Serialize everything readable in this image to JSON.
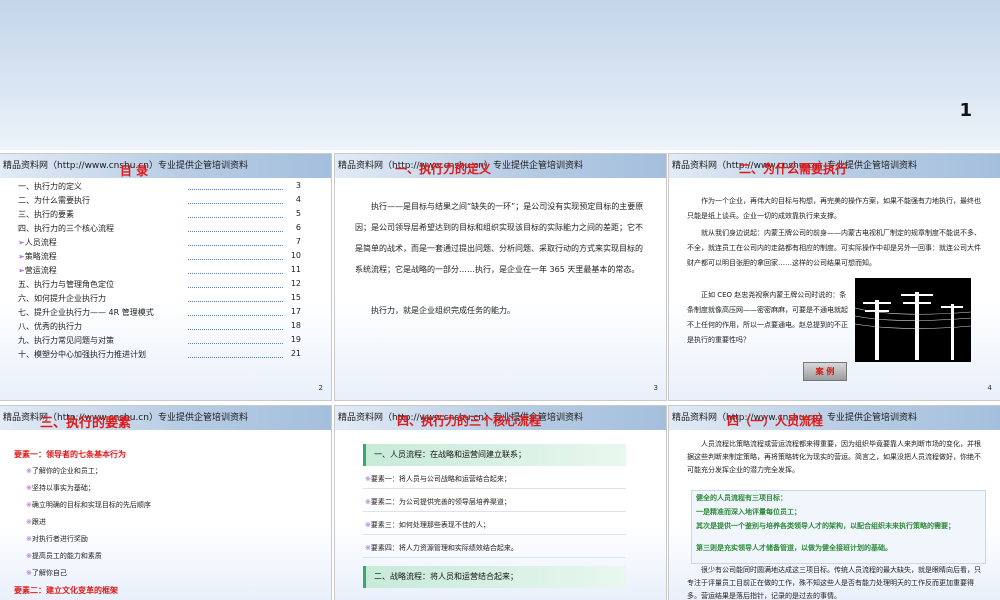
{
  "top": {
    "page_number": "1"
  },
  "header_text": "精品资料网（http://www.cnshu.cn）专业提供企管培训资料",
  "slide2": {
    "title": "目                录",
    "page": "2",
    "toc": [
      {
        "label": "一、执行力的定义",
        "page": "3"
      },
      {
        "label": "二、为什么需要执行",
        "page": "4"
      },
      {
        "label": "三、执行的要素",
        "page": "5"
      },
      {
        "label": "四、执行力的三个核心流程",
        "page": "6"
      },
      {
        "label": "人员流程",
        "page": "7"
      },
      {
        "label": "策略流程",
        "page": "10"
      },
      {
        "label": "营运流程",
        "page": "11"
      },
      {
        "label": "五、执行力与管理角色定位",
        "page": "12"
      },
      {
        "label": "六、如何提升企业执行力",
        "page": "15"
      },
      {
        "label": "七、提升企业执行力—— 4R 管理模式",
        "page": "17"
      },
      {
        "label": "八、优秀的执行力",
        "page": "18"
      },
      {
        "label": "九、执行力常见问题与对策",
        "page": "19"
      },
      {
        "label": "十、模塑分中心加强执行力推进计划",
        "page": "21"
      }
    ]
  },
  "slide3": {
    "title": "一、执行力的定义",
    "page": "3",
    "para1": "执行——是目标与结果之间“缺失的一环”；是公司没有实现预定目标的主要原因；是公司领导层希望达到的目标和组织实现该目标的实际能力之间的差距；它不是简单的战术，而是一套通过提出问题、分析问题、采取行动的方式来实现目标的系统流程；它是战略的一部分……执行，是企业在一年 365 天里最基本的常态。",
    "para2": "执行力，就是企业组织完成任务的能力。"
  },
  "slide4": {
    "title": "二、为什么需要执行",
    "page": "4",
    "para1": "作为一个企业，再伟大的目标与构想，再完美的操作方案，如果不能强有力地执行，最终也只能是纸上谈兵。企业一切的成效靠执行来支撑。",
    "para2": "就从我们身边说起：内蒙王牌公司的前身——内蒙古电视机厂制定的规章制度不能说不多、不全，就连员工在公司内的走路都有相应的制度。可实际操作中却是另外一回事：就连公司大件财产都可以明目张胆的拿回家……这样的公司结果可想而知。",
    "para3": "正如 CEO 赵忠尧视察内蒙王牌公司时说的：条条制度就像高压网——密密麻麻，可要是不通电就起不上任何的作用，所以一点要通电。赵总提到的不正是执行的重要性吗？",
    "button": "案  例"
  },
  "slide5": {
    "title": "三、执行的要素",
    "section1": "要素一：领导者的七条基本行为",
    "items": [
      "了解你的企业和员工；",
      "坚持以事实为基础；",
      "确立明确的目标和实现目标的先后顺序",
      "跟进",
      "对执行者进行奖励",
      "提高员工的能力和素质",
      "了解你自己"
    ],
    "section2": "要素二：建立文化变革的框架"
  },
  "slide6": {
    "title": "四、执行力的三个核心流程",
    "bar1": "一、人员流程：在战略和运营间建立联系；",
    "items": [
      "要素一：将人员与公司战略和运营结合起来；",
      "要素二：为公司提供完善的领导层培养渠道；",
      "要素三：如何处理那些表现不佳的人；",
      "要素四：将人力资源管理和实际绩效结合起来。"
    ],
    "bar2": "二、战略流程：将人员和运营结合起来；"
  },
  "slide7": {
    "title": "四（一）人员流程",
    "para1": "人员流程比策略流程或营运流程都来得重要，因为组织毕竟要靠人来判断市场的变化，并根据这些判断来制定策略，再将策略转化为现实的营运。简言之，如果没把人员流程做好，你绝不可能充分发挥企业的潜力完全发挥。",
    "box_title": "健全的人员流程有三项目标：",
    "box_lines": [
      "一是精准而深入地评量每位员工；",
      "其次是提供一个鉴别与培养各类领导人才的架构，以配合组织未来执行策略的需要；",
      "第三则是充实领导人才储备管道，以做为健全接班计划的基础。"
    ],
    "para2": "很少有公司能同时圆满地达成这三项目标。传统人员流程的最大缺失，就是眼睛向后看，只专注于评量员工目前正在做的工作，殊不知这些人是否有能力处理明天的工作反而更加重要得多。营运结果是落后指针，记录的是过去的事情。"
  }
}
